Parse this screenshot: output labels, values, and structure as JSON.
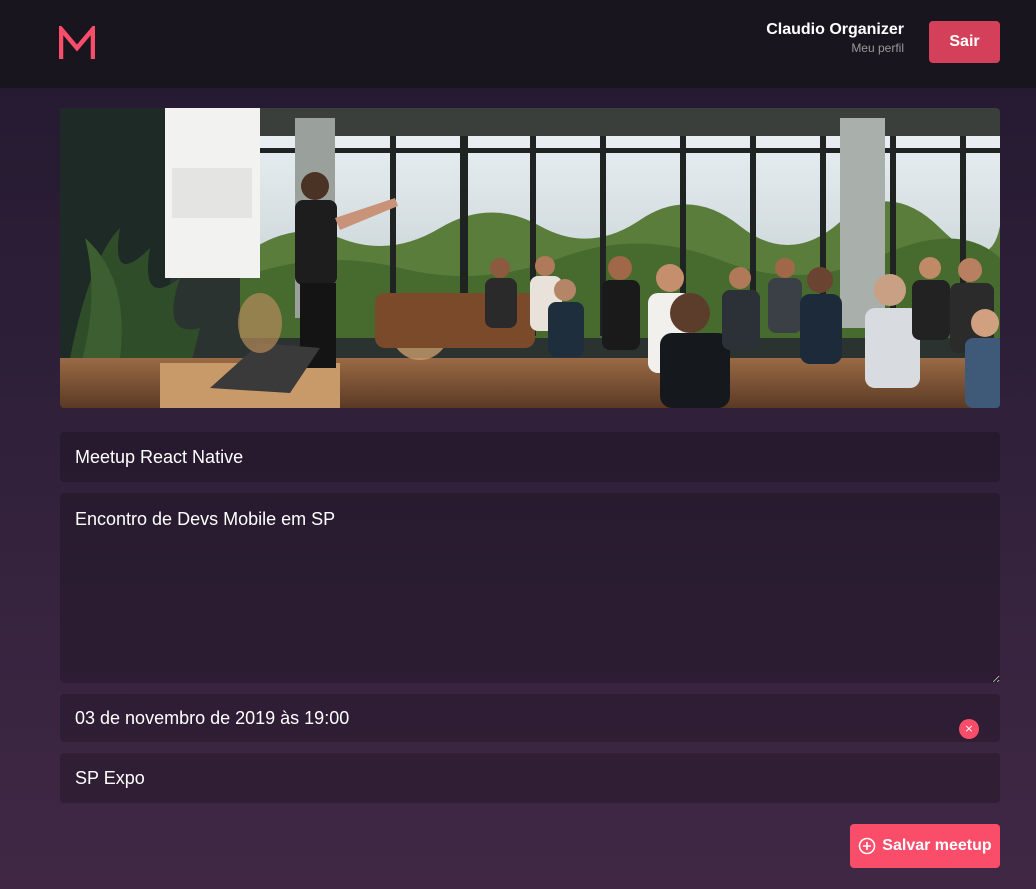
{
  "header": {
    "logo_icon": "meetapp-m-logo",
    "profile_name": "Claudio Organizer",
    "profile_link": "Meu perfil",
    "logout_label": "Sair",
    "accent_color": "#d44059"
  },
  "banner": {
    "image_description_icon": "meetup-banner-image"
  },
  "form": {
    "title_value": "Meetup React Native",
    "description_value": "Encontro de Devs Mobile em SP",
    "date_value": "03 de novembro de 2019 às 19:00",
    "clear_date_icon": "×",
    "location_value": "SP Expo",
    "save_label": "Salvar meetup",
    "save_icon": "add-circle-icon",
    "accent_color": "#f94d6a"
  }
}
